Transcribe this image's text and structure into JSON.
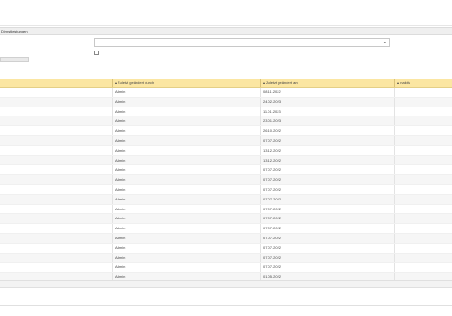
{
  "section": {
    "title": "Dienstleistungen"
  },
  "filter": {
    "select_value": "",
    "chevron_icon": "chevron-down-icon"
  },
  "table": {
    "sort_icon": "sort-icon",
    "columns": [
      {
        "label": ""
      },
      {
        "label": "Zuletzt geändert durch"
      },
      {
        "label": "Zuletzt geändert am"
      },
      {
        "label": "Inaktiv"
      }
    ],
    "rows": [
      {
        "by": "Admin",
        "date": "08.11.2022"
      },
      {
        "by": "Admin",
        "date": "24.02.2023"
      },
      {
        "by": "Admin",
        "date": "11.01.2023"
      },
      {
        "by": "Admin",
        "date": "23.01.2023"
      },
      {
        "by": "Admin",
        "date": "26.10.2022"
      },
      {
        "by": "Admin",
        "date": "07.07.2022"
      },
      {
        "by": "Admin",
        "date": "13.12.2022"
      },
      {
        "by": "Admin",
        "date": "13.12.2022"
      },
      {
        "by": "Admin",
        "date": "07.07.2022"
      },
      {
        "by": "Admin",
        "date": "07.07.2022"
      },
      {
        "by": "Admin",
        "date": "07.07.2022"
      },
      {
        "by": "Admin",
        "date": "07.07.2022"
      },
      {
        "by": "Admin",
        "date": "07.07.2022"
      },
      {
        "by": "Admin",
        "date": "07.07.2022"
      },
      {
        "by": "Admin",
        "date": "07.07.2022"
      },
      {
        "by": "Admin",
        "date": "07.07.2022"
      },
      {
        "by": "Admin",
        "date": "07.07.2022"
      },
      {
        "by": "Admin",
        "date": "07.07.2022"
      },
      {
        "by": "Admin",
        "date": "07.07.2022"
      },
      {
        "by": "Admin",
        "date": "01.05.2022"
      }
    ]
  }
}
